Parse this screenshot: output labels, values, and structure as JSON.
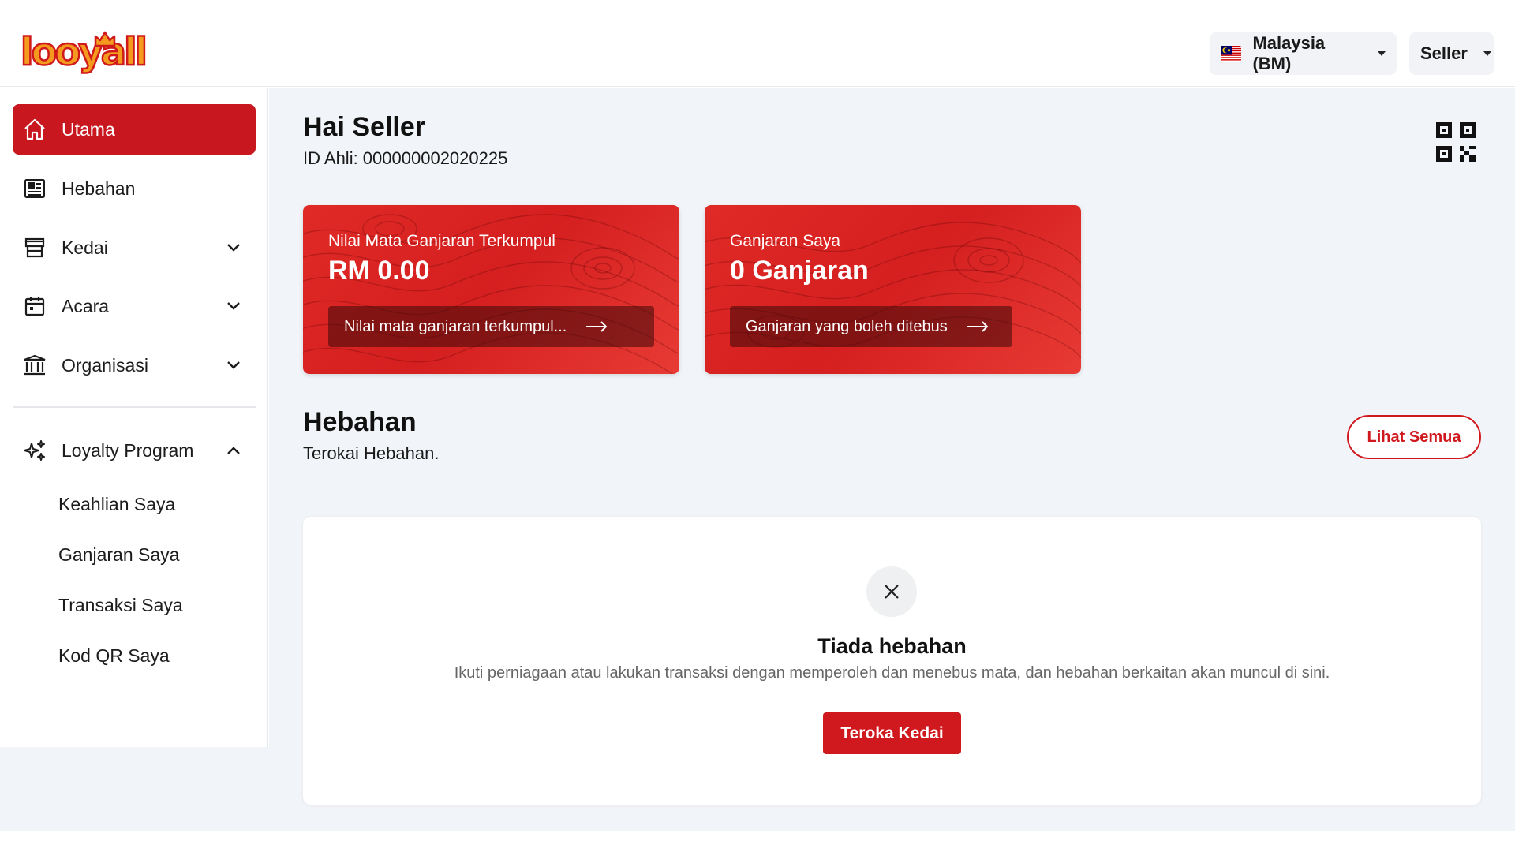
{
  "brand": {
    "logo_text": "looyall",
    "accent_color": "#d0191e"
  },
  "header": {
    "language_label": "Malaysia (BM)",
    "language_flag_icon": "malaysia-flag-icon",
    "user_label": "Seller"
  },
  "sidebar": {
    "items": [
      {
        "label": "Utama",
        "icon": "home-icon",
        "active": true
      },
      {
        "label": "Hebahan",
        "icon": "newspaper-icon"
      },
      {
        "label": "Kedai",
        "icon": "store-icon",
        "expandable": true
      },
      {
        "label": "Acara",
        "icon": "calendar-icon",
        "expandable": true
      },
      {
        "label": "Organisasi",
        "icon": "building-icon",
        "expandable": true
      }
    ],
    "loyalty": {
      "label": "Loyalty Program",
      "icon": "sparkles-icon",
      "expanded": true,
      "sub_items": [
        "Keahlian Saya",
        "Ganjaran Saya",
        "Transaksi Saya",
        "Kod QR Saya"
      ]
    }
  },
  "main": {
    "greeting": "Hai Seller",
    "member_id": "ID Ahli: 000000002020225",
    "cards": [
      {
        "label": "Nilai Mata Ganjaran Terkumpul",
        "value": "RM 0.00",
        "button": "Nilai mata ganjaran terkumpul..."
      },
      {
        "label": "Ganjaran Saya",
        "value": "0 Ganjaran",
        "button": "Ganjaran yang boleh ditebus"
      }
    ],
    "section": {
      "title": "Hebahan",
      "subtitle": "Terokai Hebahan.",
      "see_all": "Lihat Semua"
    },
    "empty_state": {
      "title": "Tiada hebahan",
      "description": "Ikuti perniagaan atau lakukan transaksi dengan memperoleh dan menebus mata, dan hebahan berkaitan akan muncul di sini.",
      "button": "Teroka Kedai"
    }
  }
}
